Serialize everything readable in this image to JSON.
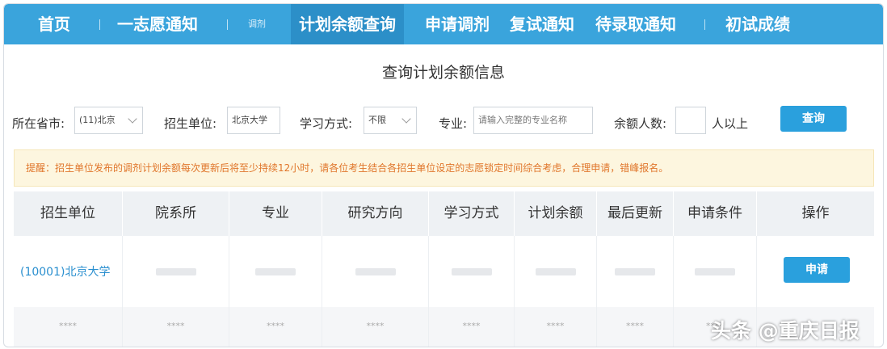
{
  "nav": [
    {
      "label": "首页",
      "active": false
    },
    {
      "label": "一志愿通知",
      "active": false
    },
    {
      "label": "调剂",
      "active": false
    },
    {
      "label": "计划余额查询",
      "active": true
    },
    {
      "label": "申请调剂",
      "active": false
    },
    {
      "label": "复试通知",
      "active": false
    },
    {
      "label": "待录取通知",
      "active": false
    },
    {
      "label": "初试成绩",
      "active": false
    }
  ],
  "page_title": "查询计划余额信息",
  "filters": {
    "province": {
      "label": "所在省市:",
      "value": "(11)北京"
    },
    "unit": {
      "label": "招生单位:",
      "value": "北京大学"
    },
    "study_mode": {
      "label": "学习方式:",
      "value": "不限"
    },
    "major": {
      "label": "专业:",
      "placeholder": "请输入完整的专业名称"
    },
    "remaining": {
      "label": "余额人数:",
      "value": "",
      "suffix": "人以上"
    },
    "query_button": "查询"
  },
  "notice": "提醒：招生单位发布的调剂计划余额每次更新后将至少持续12小时，请各位考生结合各招生单位设定的志愿锁定时间综合考虑，合理申请，错峰报名。",
  "table": {
    "columns": [
      "招生单位",
      "院系所",
      "专业",
      "研究方向",
      "学习方式",
      "计划余额",
      "最后更新",
      "申请条件",
      "操作"
    ],
    "rows": [
      {
        "unit": "(10001)北京大学",
        "action": "申请"
      }
    ],
    "masked": "****"
  },
  "watermark": "头条 @重庆日报",
  "colors": {
    "nav_bg": "#3aa4dc",
    "nav_active": "#2c8fc8",
    "button": "#2aa0dd",
    "notice_text": "#e0762b",
    "notice_bg": "#fdf6df",
    "link": "#2a8fcf"
  }
}
